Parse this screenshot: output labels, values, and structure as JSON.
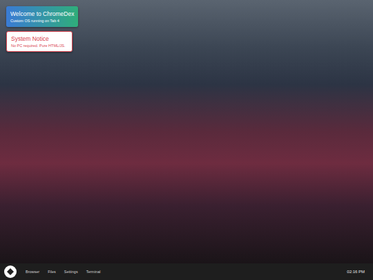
{
  "notifications": [
    {
      "title": "Welcome to ChromeDex",
      "message": "Custom OS running on Tab 4",
      "kind": "info"
    },
    {
      "title": "System Notice",
      "message": "No PC required. Pure HTML/JS.",
      "kind": "alert"
    }
  ],
  "taskbar": {
    "apps": [
      "Browser",
      "Files",
      "Settings",
      "Terminal"
    ],
    "clock": "02:16 PM"
  }
}
